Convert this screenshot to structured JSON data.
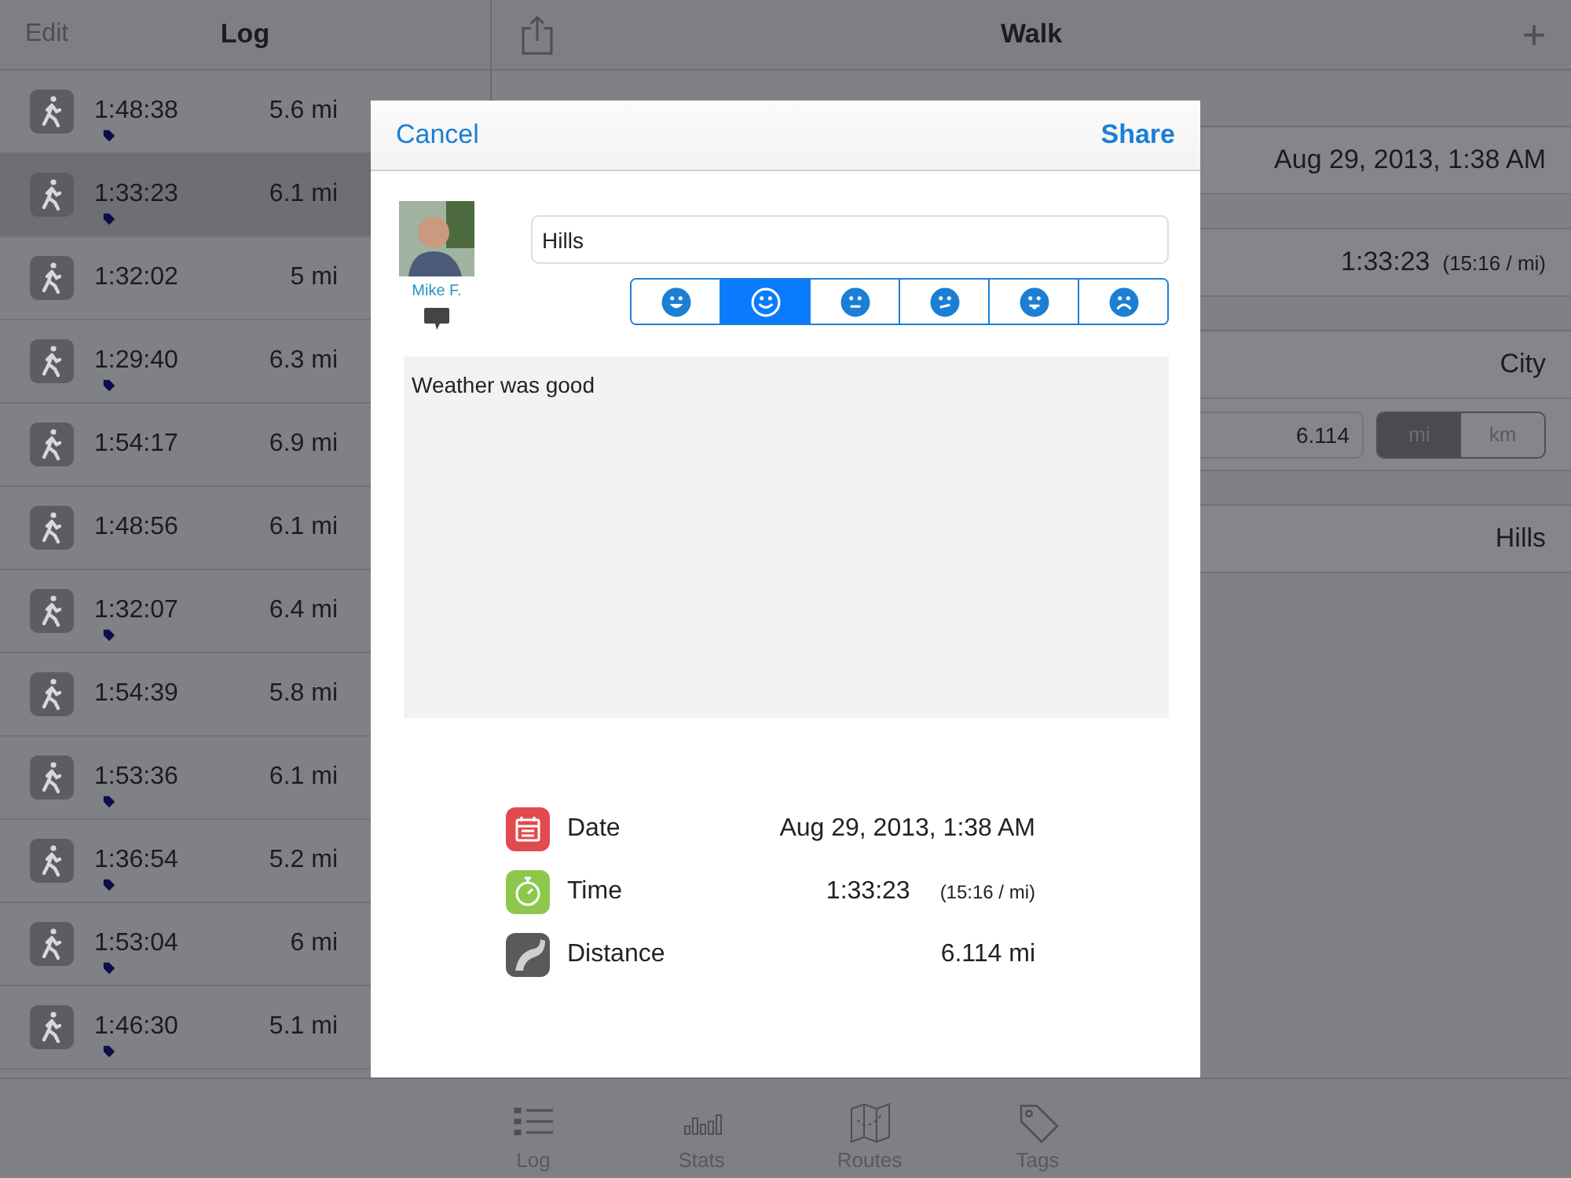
{
  "log": {
    "edit": "Edit",
    "title": "Log",
    "rows": [
      {
        "time": "1:48:38",
        "distance": "5.6 mi",
        "tagged": true,
        "selected": false
      },
      {
        "time": "1:33:23",
        "distance": "6.1 mi",
        "tagged": true,
        "selected": true
      },
      {
        "time": "1:32:02",
        "distance": "5 mi",
        "tagged": false,
        "selected": false
      },
      {
        "time": "1:29:40",
        "distance": "6.3 mi",
        "tagged": true,
        "selected": false
      },
      {
        "time": "1:54:17",
        "distance": "6.9 mi",
        "tagged": false,
        "selected": false
      },
      {
        "time": "1:48:56",
        "distance": "6.1 mi",
        "tagged": false,
        "selected": false
      },
      {
        "time": "1:32:07",
        "distance": "6.4 mi",
        "tagged": true,
        "selected": false
      },
      {
        "time": "1:54:39",
        "distance": "5.8 mi",
        "tagged": false,
        "selected": false
      },
      {
        "time": "1:53:36",
        "distance": "6.1 mi",
        "tagged": true,
        "selected": false
      },
      {
        "time": "1:36:54",
        "distance": "5.2 mi",
        "tagged": true,
        "selected": false
      },
      {
        "time": "1:53:04",
        "distance": "6 mi",
        "tagged": true,
        "selected": false
      },
      {
        "time": "1:46:30",
        "distance": "5.1 mi",
        "tagged": true,
        "selected": false
      }
    ]
  },
  "detail": {
    "title": "Walk",
    "add": "+",
    "sections": [
      [
        {
          "kind": "text",
          "value": "Aug 29, 2013, 1:38 AM"
        }
      ],
      [
        {
          "kind": "time",
          "value": "1:33:23",
          "note": "(15:16 / mi)"
        }
      ],
      [
        {
          "kind": "text",
          "value": "City"
        },
        {
          "kind": "distance",
          "value": "6.114",
          "units": [
            {
              "label": "mi",
              "selected": true
            },
            {
              "label": "km",
              "selected": false
            }
          ]
        }
      ],
      [
        {
          "kind": "text",
          "value": "Hills"
        }
      ]
    ]
  },
  "share": {
    "cancel": "Cancel",
    "action": "Share",
    "user": "Mike F.",
    "name": "Hills",
    "moods": [
      {
        "kind": "grin",
        "selected": false
      },
      {
        "kind": "smile",
        "selected": true
      },
      {
        "kind": "neutral",
        "selected": false
      },
      {
        "kind": "confused",
        "selected": false
      },
      {
        "kind": "tongue",
        "selected": false
      },
      {
        "kind": "sad",
        "selected": false
      }
    ],
    "notes": "Weather was good",
    "info": [
      {
        "kind": "date",
        "label": "Date",
        "value": "Aug 29, 2013, 1:38 AM"
      },
      {
        "kind": "time",
        "label": "Time",
        "value": "1:33:23",
        "note": "(15:16 / mi)"
      },
      {
        "kind": "distance",
        "label": "Distance",
        "value": "6.114 mi"
      }
    ]
  },
  "tabs": [
    {
      "kind": "log",
      "label": "Log"
    },
    {
      "kind": "stats",
      "label": "Stats"
    },
    {
      "kind": "routes",
      "label": "Routes"
    },
    {
      "kind": "tags",
      "label": "Tags"
    }
  ]
}
